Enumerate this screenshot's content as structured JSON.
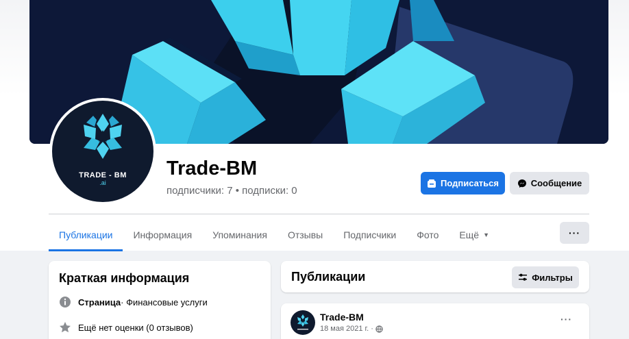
{
  "page": {
    "name": "Trade-BM",
    "stats": "подписчики: 7 • подписки: 0",
    "avatar_brand": "TRADE - BM",
    "avatar_brand_sub": ".ai"
  },
  "actions": {
    "subscribe_label": "Подписаться",
    "message_label": "Сообщение",
    "more_label": "···"
  },
  "tabs": [
    {
      "label": "Публикации",
      "active": true
    },
    {
      "label": "Информация"
    },
    {
      "label": "Упоминания"
    },
    {
      "label": "Отзывы"
    },
    {
      "label": "Подписчики"
    },
    {
      "label": "Фото"
    },
    {
      "label": "Ещё"
    }
  ],
  "intro": {
    "title": "Краткая информация",
    "category_prefix": "Страница",
    "category_value": " · Финансовые услуги",
    "rating_text": "Ещё нет оценки (0 отзывов)"
  },
  "publications": {
    "title": "Публикации",
    "filter_label": "Фильтры"
  },
  "post": {
    "author": "Trade-BM",
    "date": "18 мая 2021 г. ·",
    "more_label": "···"
  },
  "colors": {
    "accent": "#1b74e4",
    "cover_bg": "#0d1838",
    "cube": "#3fd0ee"
  },
  "icons": {
    "subscribe": "subscribe-icon",
    "message": "messenger-icon",
    "info": "info-icon",
    "star": "star-icon",
    "filter": "filter-icon",
    "globe": "globe-icon",
    "caret": "caret-down-icon"
  }
}
